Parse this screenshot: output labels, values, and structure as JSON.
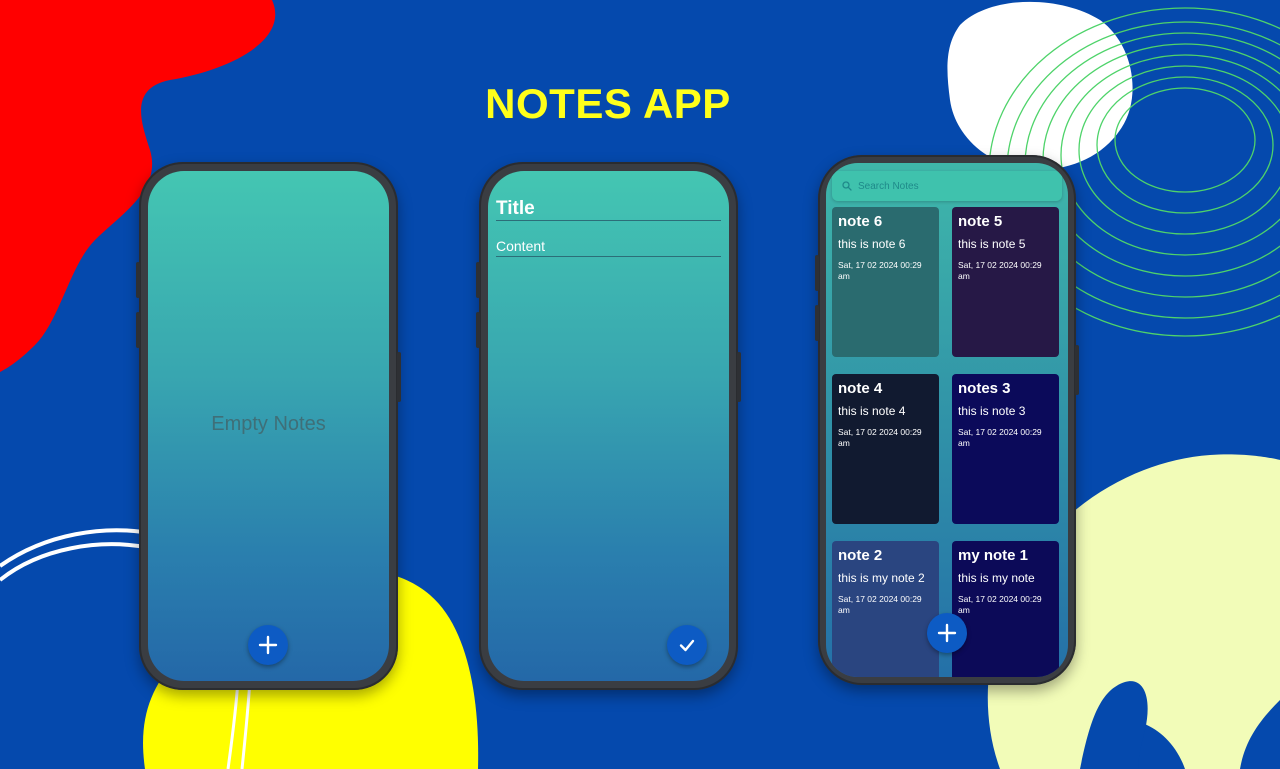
{
  "page": {
    "headline": "NOTES APP",
    "headline_color": "#ffff1a",
    "background_color": "#0549ad"
  },
  "empty_screen": {
    "empty_label": "Empty Notes",
    "label_color": "#3f6f78",
    "fab_icon": "plus-icon"
  },
  "editor_screen": {
    "title_placeholder": "Title",
    "content_placeholder": "Content",
    "fab_icon": "check-icon"
  },
  "list_screen": {
    "search_placeholder": "Search Notes",
    "search_icon": "search-icon",
    "fab_icon": "plus-icon",
    "notes": [
      {
        "title": "note 6",
        "body": "this is note 6",
        "date": "Sat, 17 02 2024 00:29 am",
        "color": "#2a6b6f"
      },
      {
        "title": "note 5",
        "body": "this is note 5",
        "date": "Sat, 17 02 2024 00:29 am",
        "color": "#261846"
      },
      {
        "title": "note 4",
        "body": "this is note 4",
        "date": "Sat, 17 02 2024 00:29 am",
        "color": "#111a30"
      },
      {
        "title": "notes 3",
        "body": "this is note 3",
        "date": "Sat, 17 02 2024 00:29 am",
        "color": "#0b0a5a"
      },
      {
        "title": "note 2",
        "body": "this is my note 2",
        "date": "Sat, 17 02 2024 00:29 am",
        "color": "#2a4580"
      },
      {
        "title": "my note 1",
        "body": "this is my note",
        "date": "Sat, 17 02 2024 00:29 am",
        "color": "#0c0a58"
      }
    ]
  },
  "colors": {
    "fab": "#0d5bc4",
    "deco_red": "#ff0000",
    "deco_yellow": "#ffff00",
    "deco_cream": "#f2fcb8",
    "deco_white": "#ffffff",
    "deco_green_lines": "#4ed36a"
  }
}
